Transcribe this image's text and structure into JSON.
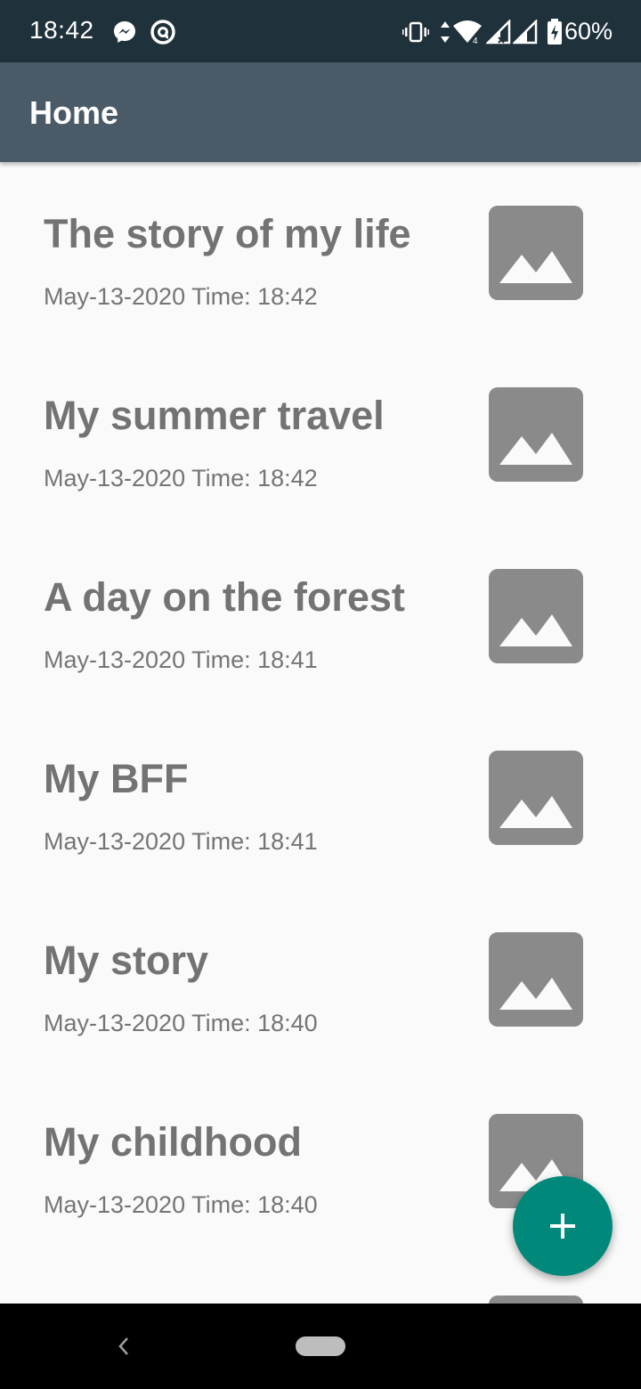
{
  "status_bar": {
    "time": "18:42",
    "battery_percent": "60%",
    "icons": [
      "messenger-icon",
      "app-notification-icon",
      "vibrate-icon",
      "data-arrows-icon",
      "wifi-icon",
      "signal-icon",
      "signal-no-service-icon",
      "battery-charging-icon"
    ]
  },
  "app_bar": {
    "title": "Home"
  },
  "entries": [
    {
      "title": "The story of my life",
      "date": "May-13-2020 Time: 18:42"
    },
    {
      "title": "My summer travel",
      "date": "May-13-2020 Time: 18:42"
    },
    {
      "title": "A day on the forest",
      "date": "May-13-2020 Time: 18:41"
    },
    {
      "title": "My BFF",
      "date": "May-13-2020 Time: 18:41"
    },
    {
      "title": "My story",
      "date": "May-13-2020 Time: 18:40"
    },
    {
      "title": "My childhood",
      "date": "May-13-2020 Time: 18:40"
    }
  ],
  "fab": {
    "icon": "plus-icon"
  },
  "colors": {
    "status_bar": "#1f313b",
    "app_bar": "#4a5b67",
    "fab": "#00897b",
    "thumbnail": "#8a8a8a"
  }
}
